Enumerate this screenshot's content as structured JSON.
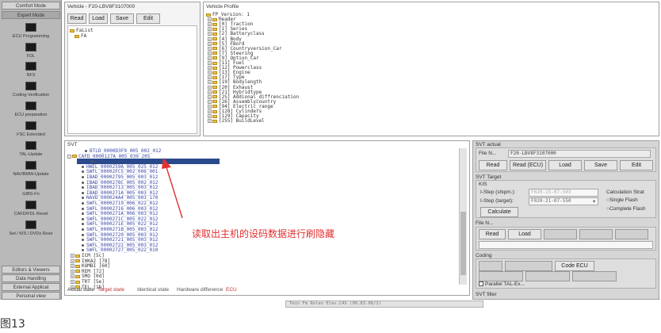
{
  "sidebar": {
    "tabs": [
      "Comfort Mode",
      "Expert Mode"
    ],
    "items": [
      "ECU Programming",
      "FDL",
      "NFS",
      "Coding-Verification",
      "ECU preparation",
      "FSC Extended",
      "TAL-Update",
      "NAV/BMW-Update",
      "GIBS-Fn",
      "CAFD/FDL Reset",
      "Set / KIS / DVDx Rese"
    ],
    "bottom_tabs": [
      "Editors & Viewers",
      "Data Handling",
      "External Applicat",
      "Personal view"
    ]
  },
  "vehicle": {
    "title": "Vehicle - F20-LBV8F3107000",
    "buttons": [
      "Read",
      "Load",
      "Save",
      "Edit"
    ],
    "tree": [
      "FaList",
      "FA"
    ]
  },
  "profile": {
    "title": "Vehicle Profile",
    "items": [
      "FP_Version: 1",
      "Header",
      "[0] Traction",
      "[1] Series",
      "[2] Batteryclass",
      "[4] Body",
      "[5] FBord",
      "[6] Countryversion_Car",
      "[7] Steering",
      "[9] Option_Car",
      "[11] Fuel",
      "[12] Powerclass",
      "[13] Engine",
      "[17] Type",
      "[19] Bodylength",
      "[20] Exhaust",
      "[21] Hybridtype",
      "[25] Addional_diffrenciation",
      "[26] Assemblycountry",
      "[94] Electric_range",
      "[128] Cylinders",
      "[129] Capacity",
      "[255] BuildLevel"
    ]
  },
  "svt": {
    "title": "SVT",
    "rows_top": [
      "BTLD_0000D3F9_005_002_012",
      "CAFD_0000127A_005_039_205"
    ],
    "selected_row": "CAFD_0000127A_005_039_205",
    "rows": [
      "HWEL_0000259A_005_025_012",
      "SWFL_00002FC5_002_006_001",
      "IBAD_00002795_005_003_012",
      "IBAD_0000278C_005_002_012",
      "IBAD_00002713_005_003_012",
      "IBAD_0000271A_005_003_012",
      "NAVD_000024A4_005_003_170",
      "SWFL_00002719_006_022_012",
      "SWFL_00002716_006_003_012",
      "SWFL_0000271A_006_003_012",
      "SWFL_0000271C_005_022_012",
      "SWFL_0000271E_005_022_012",
      "SWFL_0000271B_005_003_012",
      "SWFL_00002720_005_003_012",
      "SWFL_00002721_005_003_012",
      "SWFL_00002722_005_003_012",
      "SWFL_00002727_005_022_010"
    ],
    "ecus": [
      "ICM [5c]",
      "IHKA2 [78]",
      "KOMBI [60]",
      "REM [72]",
      "SMO [0d]",
      "TRT [5e]",
      "TEL [1b]"
    ],
    "legend": [
      "Actual state",
      "Target state",
      "Identical state",
      "Hardware difference",
      "ECU"
    ]
  },
  "annotation": "读取出主机的设码数据进行刷隐藏",
  "caption": "图13",
  "right": {
    "svt_actual": "SVT actual",
    "file_label": "File N...",
    "file_value": "F20-LBV8F3107000",
    "actual_buttons": [
      "Read",
      "Read (ECU)",
      "Load",
      "Save",
      "Edit"
    ],
    "svt_target": "SVT Target",
    "kis": "KIS",
    "istep_current_label": "I-Step (shipm.):",
    "istep_current_value": "F020-15-07-503",
    "istep_target_label": "I-Step (target):",
    "istep_target_value": "F020-21-07-550",
    "calc_strategy": "Calculation Strat",
    "single_flash": "Single Flash",
    "complete_flash": "Complete Flash",
    "calculate": "Calculate",
    "file_label2": "File N...",
    "file_buttons": [
      "Read",
      "Load",
      "",
      "",
      ""
    ],
    "coding": "Coding",
    "coding_buttons": [
      "",
      "",
      "Code ECU"
    ],
    "parallel": "Parallel TAL-Ex...",
    "svt_filter": "SVT filter"
  },
  "statusbar": "Tmin   Fm   Rolen  Elev.CAS  (00.83.06/1)"
}
